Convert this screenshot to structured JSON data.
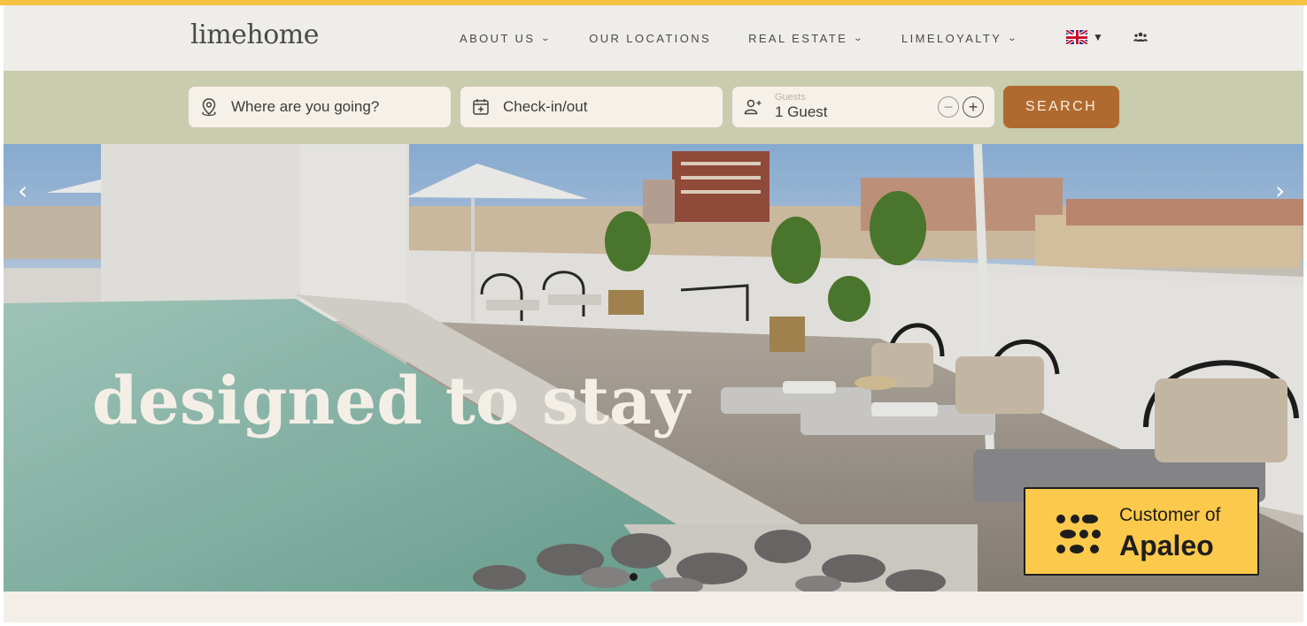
{
  "brand": {
    "logo": "limehome"
  },
  "nav": {
    "items": [
      {
        "label": "ABOUT US",
        "has_dropdown": true
      },
      {
        "label": "OUR LOCATIONS",
        "has_dropdown": false
      },
      {
        "label": "REAL ESTATE",
        "has_dropdown": true
      },
      {
        "label": "LIMELOYALTY",
        "has_dropdown": true
      }
    ],
    "language_icon": "uk-flag-icon",
    "account_icon": "users-icon"
  },
  "search": {
    "destination_placeholder": "Where are you going?",
    "dates_placeholder": "Check-in/out",
    "guests_label": "Guests",
    "guests_value": "1 Guest",
    "button_label": "SEARCH"
  },
  "hero": {
    "headline": "designed to stay",
    "slide_count": 1,
    "active_slide": 1
  },
  "badge": {
    "prefix": "Customer of",
    "name": "Apaleo"
  },
  "colors": {
    "accent_top": "#f5c242",
    "search_band": "#c9ccad",
    "search_button": "#b06a30",
    "badge": "#fbc94b"
  }
}
